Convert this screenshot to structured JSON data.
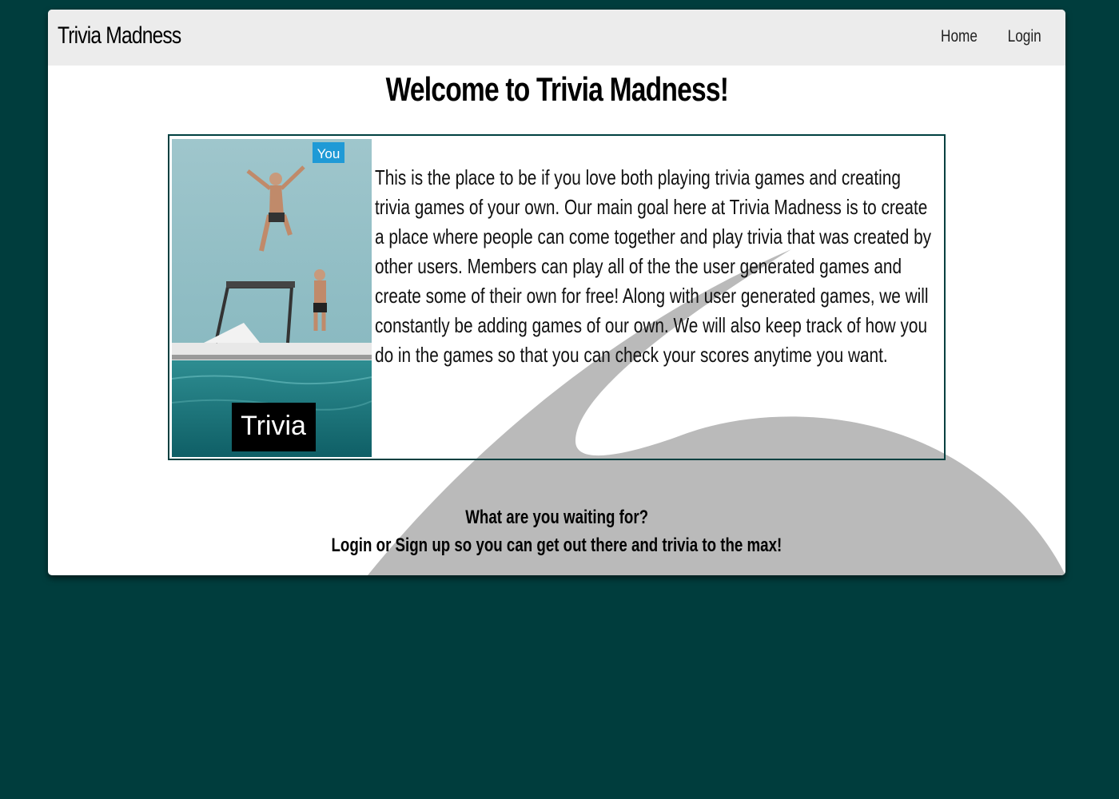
{
  "app": {
    "brand": "Trivia Madness",
    "colors": {
      "background": "#003d3d",
      "navbar": "#ececec",
      "accent_border": "#004040",
      "swoosh": "#bababa"
    }
  },
  "nav": {
    "items": [
      {
        "label": "Home"
      },
      {
        "label": "Login"
      }
    ]
  },
  "main": {
    "title": "Welcome to Trivia Madness!",
    "image": {
      "badge": "You",
      "caption": "Trivia"
    },
    "about": "This is the place to be if you love both playing trivia games and creating trivia games of your own. Our main goal here at Trivia Madness is to create a place where people can come together and play trivia that was created by other users. Members can play all of the the user generated games and create some of their own for free! Along with user generated games, we will constantly be adding games of our own. We will also keep track of how you do in the games so that you can check your scores anytime you want."
  },
  "cta": {
    "line1": "What are you waiting for?",
    "line2": "Login or Sign up so you can get out there and trivia to the max!"
  }
}
